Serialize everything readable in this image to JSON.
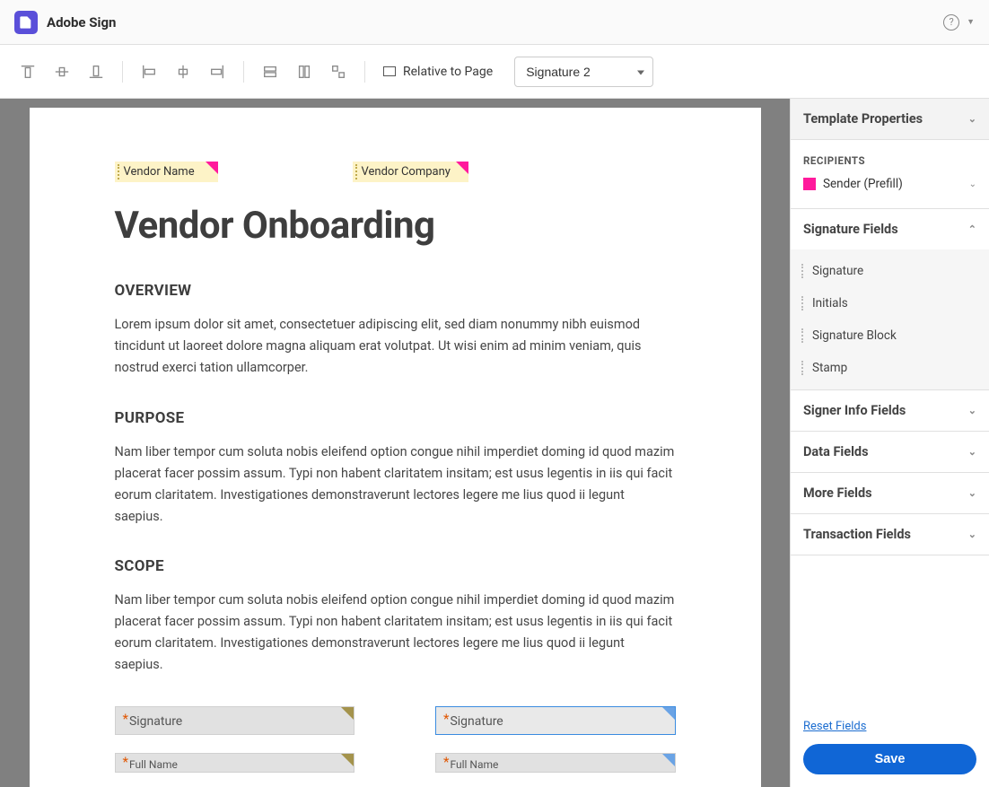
{
  "app": {
    "title": "Adobe Sign"
  },
  "toolbar": {
    "relative_label": "Relative to Page",
    "selected_field": "Signature 2"
  },
  "document": {
    "tag1": "Vendor Name",
    "tag2": "Vendor Company",
    "title": "Vendor Onboarding",
    "overview_head": "OVERVIEW",
    "overview_body": "Lorem ipsum dolor sit amet, consectetuer adipiscing elit, sed diam nonummy nibh euismod tincidunt ut laoreet dolore magna aliquam erat volutpat. Ut wisi enim ad minim veniam, quis nostrud exerci tation ullamcorper.",
    "purpose_head": "PURPOSE",
    "purpose_body": "Nam liber tempor cum soluta nobis eleifend option congue nihil imperdiet doming id quod mazim placerat facer possim assum. Typi non habent claritatem insitam; est usus legentis in iis qui facit eorum claritatem. Investigationes demonstraverunt lectores legere me lius quod ii legunt saepius.",
    "scope_head": "SCOPE",
    "scope_body": "Nam liber tempor cum soluta nobis eleifend option congue nihil imperdiet doming id quod mazim placerat facer possim assum. Typi non habent claritatem insitam; est usus legentis in iis qui facit eorum claritatem. Investigationes demonstraverunt lectores legere me lius quod ii legunt saepius.",
    "sig1": "Signature",
    "sig2": "Signature",
    "name1": "Full Name",
    "name2": "Full Name"
  },
  "panel": {
    "template_props": "Template Properties",
    "recipients_label": "RECIPIENTS",
    "recipient_name": "Sender (Prefill)",
    "sections": {
      "signature_fields": "Signature Fields",
      "signer_info": "Signer Info Fields",
      "data_fields": "Data Fields",
      "more_fields": "More Fields",
      "transaction_fields": "Transaction Fields"
    },
    "field_types": [
      "Signature",
      "Initials",
      "Signature Block",
      "Stamp"
    ],
    "reset": "Reset Fields",
    "save": "Save"
  }
}
